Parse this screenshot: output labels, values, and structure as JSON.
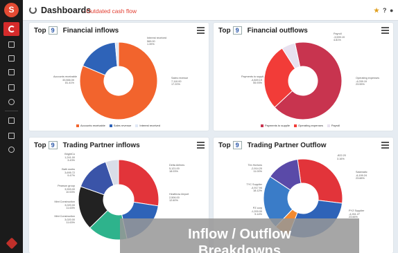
{
  "header": {
    "title": "Dashboards",
    "subtitle": "- Outdated cash flow",
    "top_icons": [
      "bookmark-star-icon",
      "help-icon",
      "user-icon"
    ],
    "help_glyph": "?"
  },
  "sidebar": {
    "logo_letter": "S",
    "items": [
      "dashboard-icon",
      "chart-icon",
      "report-icon",
      "list-icon",
      "transfer-icon",
      "percent-icon",
      "wallet-icon",
      "document-icon",
      "settings-icon"
    ]
  },
  "cards": [
    {
      "top_label": "Top",
      "top_count": "9",
      "title": "Financial inflows",
      "labels": [
        {
          "name": "Interest received",
          "value": "569.00",
          "pct": "1.39%"
        },
        {
          "name": "Accounts receivable",
          "value": "33,566.00",
          "pct": "81.41%"
        },
        {
          "name": "Sales revenue",
          "value": "7,110.00",
          "pct": "17.20%"
        }
      ],
      "legend": [
        "Accounts receivable",
        "Sales revenue",
        "Interest received"
      ]
    },
    {
      "top_label": "Top",
      "top_count": "9",
      "title": "Financial outflows",
      "labels": [
        {
          "name": "Payroll",
          "value": "-3,599.19",
          "pct": "4.81%"
        },
        {
          "name": "Payments to suppli...",
          "value": "-4,849.19",
          "pct": "55.93%"
        },
        {
          "name": "Operating expenses",
          "value": "-4,039.19",
          "pct": "23.55%"
        }
      ],
      "legend": [
        "Payments to supplie",
        "Operating expenses",
        "Payroll"
      ]
    },
    {
      "top_label": "Top",
      "top_count": "9",
      "title": "Trading Partner inflows",
      "labels": [
        {
          "name": "BrightCo",
          "value": "1,241.00",
          "pct": "3.43%"
        },
        {
          "name": "Bath works",
          "value": "3,695.72",
          "pct": "9.47%"
        },
        {
          "name": "Pearson group",
          "value": "3,993.00",
          "pct": "10.53%"
        },
        {
          "name": "Mint Construction",
          "value": "3,020.00",
          "pct": "11.63%"
        },
        {
          "name": "Mint Construction",
          "value": "3,020.00",
          "pct": "11.63%"
        },
        {
          "name": "Delta Airlines",
          "value": "5,121.00",
          "pct": "18.03%"
        },
        {
          "name": "Heathrow Airport",
          "value": "2,506.00",
          "pct": "12.60%"
        }
      ]
    },
    {
      "top_label": "Top",
      "top_count": "9",
      "title": "Trading Partner Outflow",
      "labels": [
        {
          "name": "",
          "value": "-822.20",
          "pct": "3.16%"
        },
        {
          "name": "Tim Hortons",
          "value": "-2,914.20",
          "pct": "11.00%"
        },
        {
          "name": "TYC Supplier",
          "value": "-4,917.94",
          "pct": "18.12%"
        },
        {
          "name": "PZ corp",
          "value": "-1,200.00",
          "pct": "5.14%"
        },
        {
          "name": "Salamatic",
          "value": "-6,199.24",
          "pct": "23.88%"
        },
        {
          "name": "PYZ Supplier",
          "value": "-4,261.27",
          "pct": "23.66%"
        }
      ]
    }
  ],
  "overlay": {
    "line1": "Inflow / Outflow",
    "line2": "Breakdowns"
  },
  "chart_data": [
    {
      "type": "pie",
      "title": "Financial inflows",
      "categories": [
        "Accounts receivable",
        "Sales revenue",
        "Interest received"
      ],
      "values": [
        81.41,
        17.2,
        1.39
      ],
      "colors": [
        "#f2642d",
        "#2e63b8",
        "#e0e8f6"
      ]
    },
    {
      "type": "pie",
      "title": "Financial outflows",
      "categories": [
        "Payments to supplier",
        "Operating expenses",
        "Payroll"
      ],
      "values": [
        55.93,
        23.55,
        4.81
      ],
      "colors": [
        "#c8344f",
        "#f23c38",
        "#e8e1ef"
      ]
    },
    {
      "type": "pie",
      "title": "Trading Partner inflows",
      "categories": [
        "Delta Airlines",
        "Heathrow Airport",
        "Pearson group",
        "Mint Construction",
        "Bath works",
        "BrightCo"
      ],
      "values": [
        18.03,
        12.6,
        10.53,
        11.63,
        9.47,
        3.43
      ],
      "colors": [
        "#e2343a",
        "#2e63b8",
        "#2eb38c",
        "#222222",
        "#3a54a8",
        "#d9dde8"
      ]
    },
    {
      "type": "pie",
      "title": "Trading Partner Outflow",
      "categories": [
        "Salamatic",
        "PYZ Supplier",
        "PZ corp",
        "TYC Supplier",
        "Tim Hortons"
      ],
      "values": [
        23.88,
        23.66,
        5.14,
        18.12,
        11.0
      ],
      "colors": [
        "#e2343a",
        "#2e63b8",
        "#f28a30",
        "#3a7cc8",
        "#5a4aa8"
      ]
    }
  ]
}
